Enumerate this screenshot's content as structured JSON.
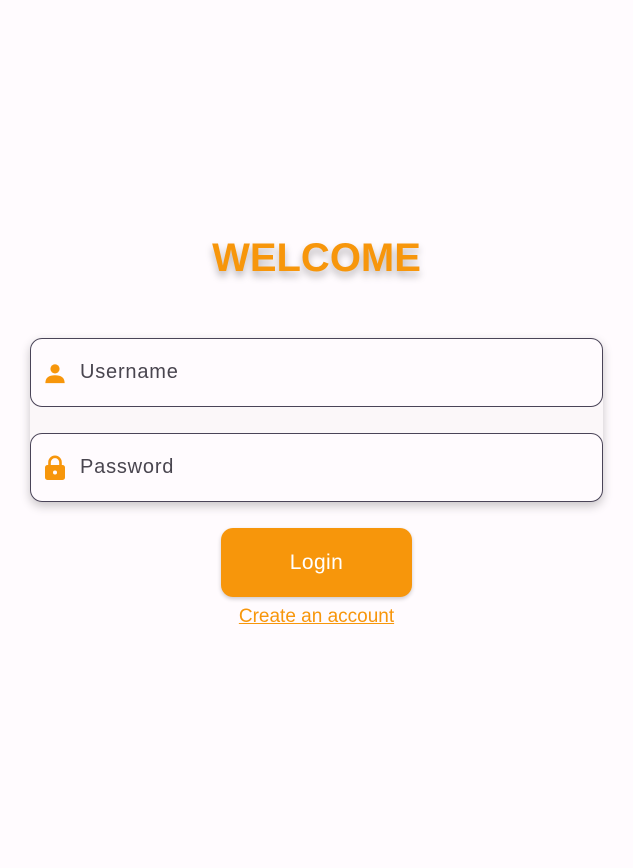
{
  "header": {
    "title": "WELCOME"
  },
  "form": {
    "username": {
      "placeholder": "Username",
      "value": "",
      "icon": "person-icon"
    },
    "password": {
      "placeholder": "Password",
      "value": "",
      "icon": "lock-icon"
    }
  },
  "actions": {
    "login_label": "Login",
    "create_account_label": "Create an account"
  },
  "colors": {
    "accent": "#f7960b",
    "background": "#fffbfe",
    "text": "#49454f",
    "border": "#4a4458"
  }
}
